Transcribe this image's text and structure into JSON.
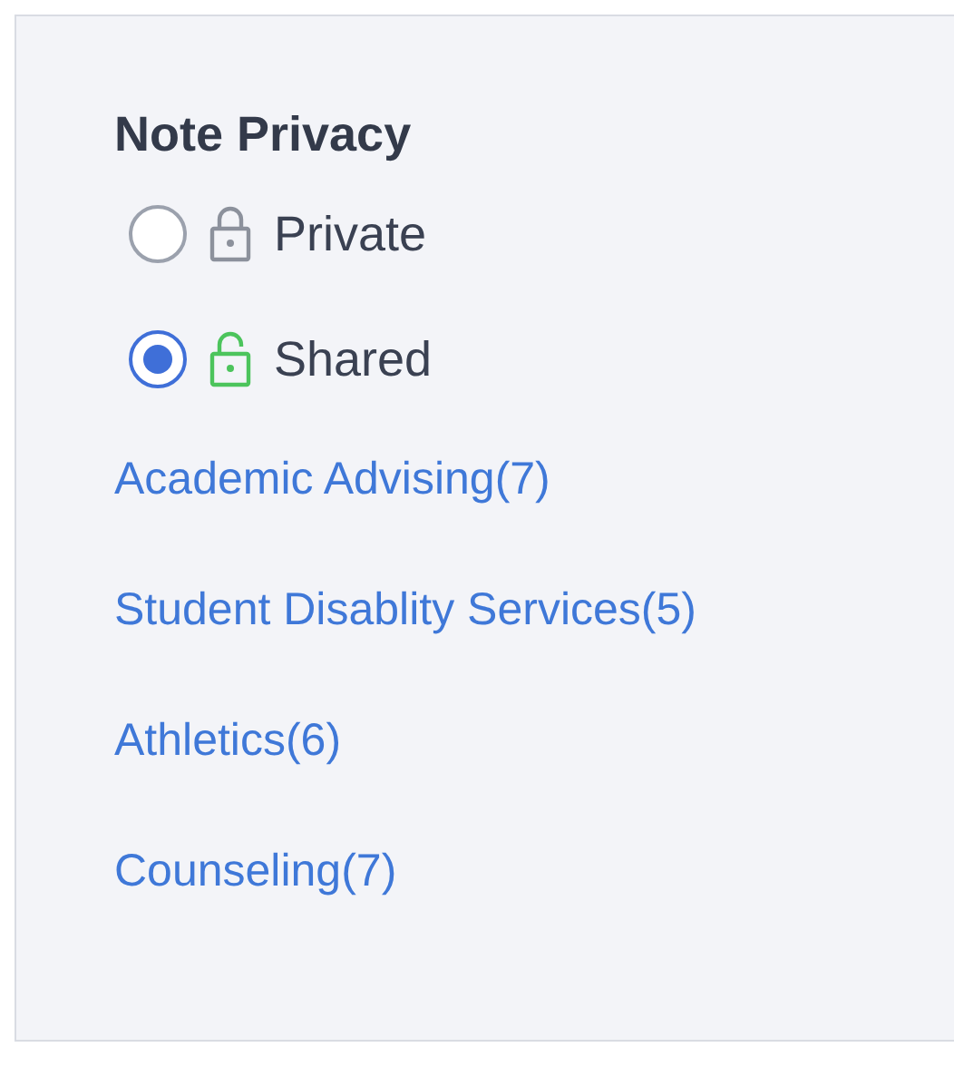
{
  "title": "Note Privacy",
  "options": [
    {
      "label": "Private",
      "kind": "locked",
      "selected": false
    },
    {
      "label": "Shared",
      "kind": "unlocked",
      "selected": true
    }
  ],
  "links": [
    "Academic Advising(7)",
    "Student Disablity Services(5)",
    "Athletics(6)",
    "Counseling(7)"
  ]
}
